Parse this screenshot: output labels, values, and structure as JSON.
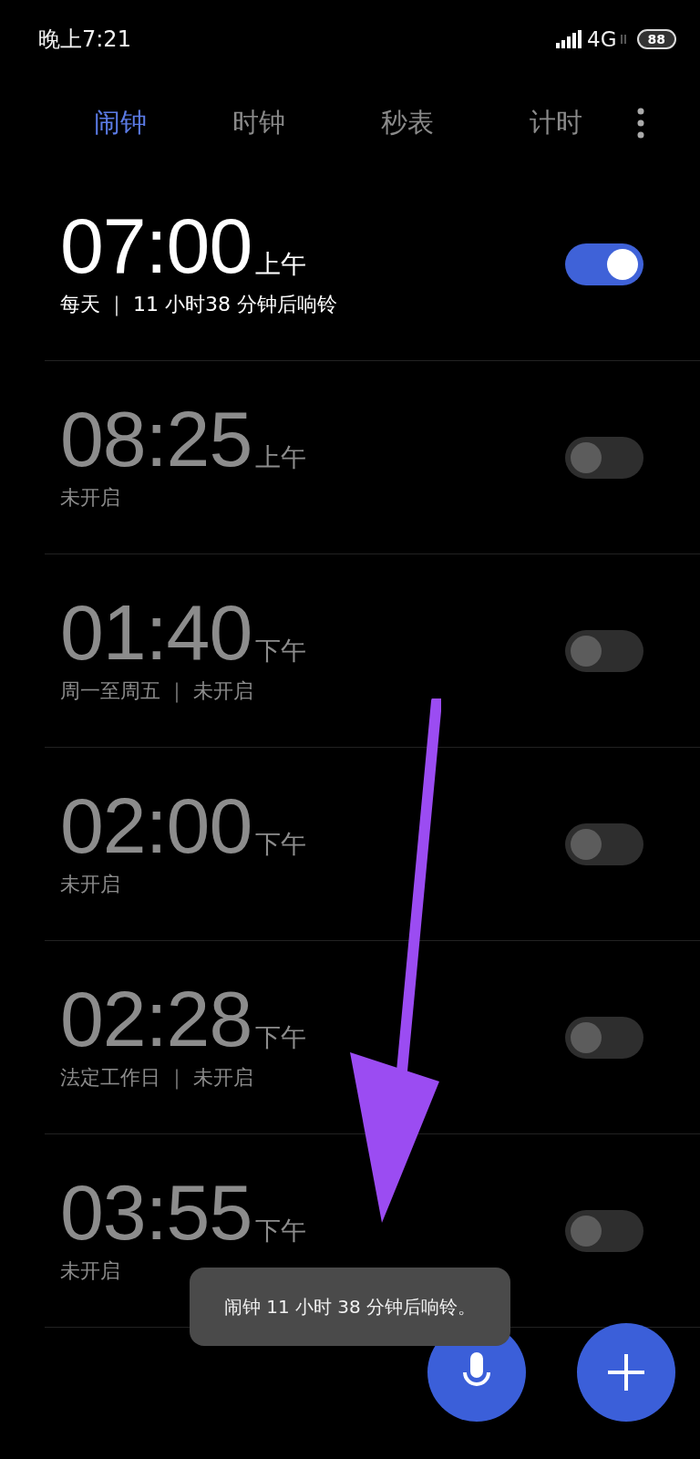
{
  "status_bar": {
    "time": "晚上7:21",
    "network": "4G",
    "battery": "88"
  },
  "tabs": [
    {
      "label": "闹钟",
      "selected": true
    },
    {
      "label": "时钟",
      "selected": false
    },
    {
      "label": "秒表",
      "selected": false
    },
    {
      "label": "计时",
      "selected": false
    }
  ],
  "alarms": [
    {
      "time": "07:00",
      "period": "上午",
      "subtitle": "每天 ｜ 11 小时38 分钟后响铃",
      "on": true
    },
    {
      "time": "08:25",
      "period": "上午",
      "subtitle": "未开启",
      "on": false
    },
    {
      "time": "01:40",
      "period": "下午",
      "subtitle": "周一至周五 ｜ 未开启",
      "on": false
    },
    {
      "time": "02:00",
      "period": "下午",
      "subtitle": "未开启",
      "on": false
    },
    {
      "time": "02:28",
      "period": "下午",
      "subtitle": "法定工作日 ｜ 未开启",
      "on": false
    },
    {
      "time": "03:55",
      "period": "下午",
      "subtitle": "未开启",
      "on": false
    }
  ],
  "toast": "闹钟 11 小时 38 分钟后响铃。"
}
